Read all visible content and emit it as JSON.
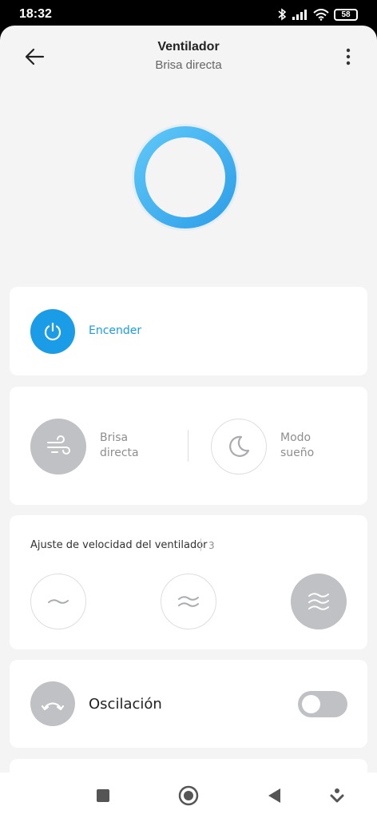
{
  "status_bar": {
    "time": "18:32",
    "battery": "58"
  },
  "header": {
    "title": "Ventilador",
    "subtitle": "Brisa directa"
  },
  "power": {
    "label": "Encender",
    "accent": "#1a9ce6"
  },
  "modes": [
    {
      "line1": "Brisa",
      "line2": "directa",
      "icon": "wind-icon",
      "selected": true
    },
    {
      "line1": "Modo",
      "line2": "sueño",
      "icon": "moon-icon",
      "selected": false
    }
  ],
  "speed": {
    "title": "Ajuste de velocidad del ventilador",
    "value": "3",
    "levels": [
      "1",
      "2",
      "3"
    ]
  },
  "oscillation": {
    "label": "Oscilación",
    "enabled": false
  },
  "colors": {
    "accent": "#1a9ce6",
    "inactive": "#bfc1c4",
    "background": "#f4f4f4"
  }
}
